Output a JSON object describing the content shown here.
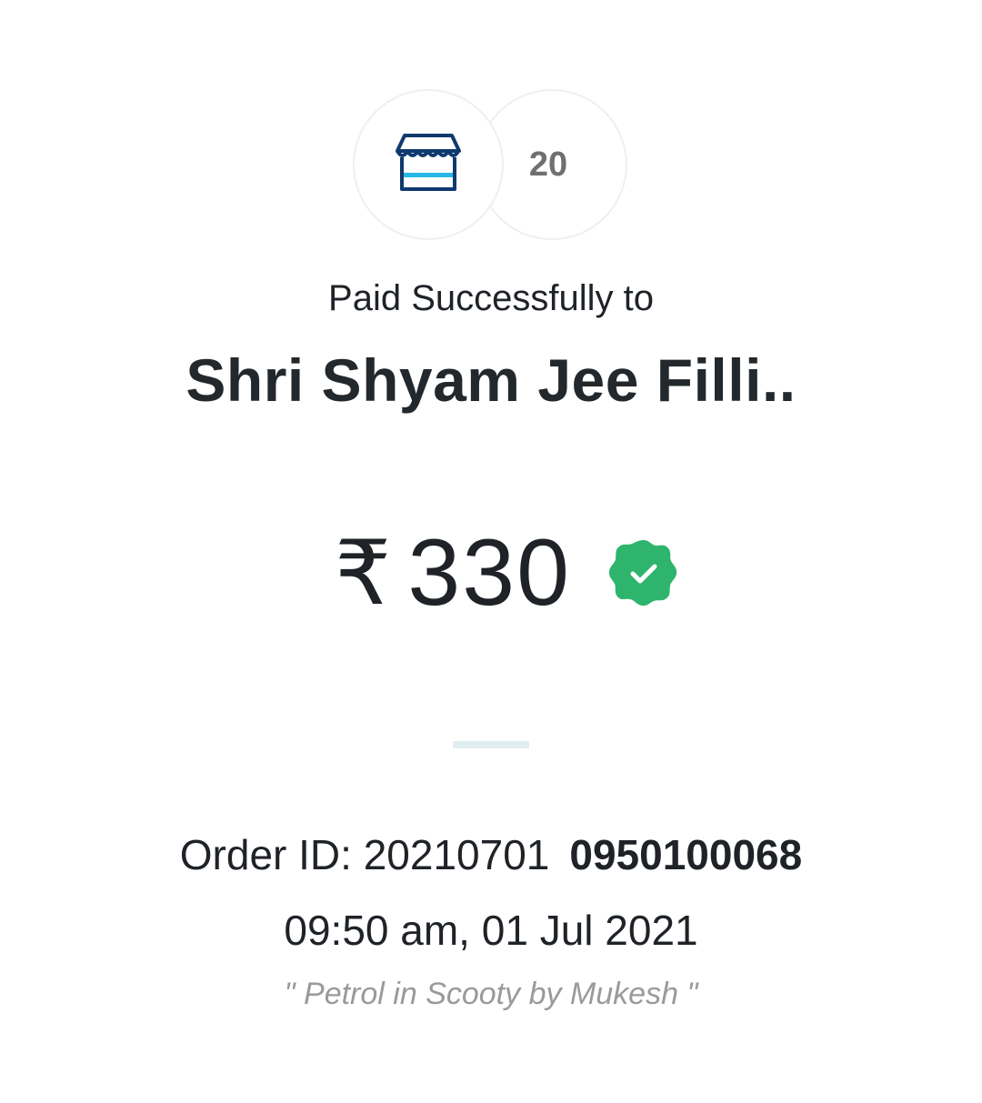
{
  "avatars": {
    "merchant_icon": "storefront-icon",
    "count": "20"
  },
  "payment": {
    "status_label": "Paid Successfully to",
    "merchant_name": "Shri Shyam Jee Filli..",
    "currency_symbol": "₹",
    "amount": "330",
    "verified_icon": "verified-check-badge-icon"
  },
  "order": {
    "label": "Order ID: 20210701",
    "id_bold": "0950100068",
    "datetime": "09:50 am, 01 Jul 2021",
    "note": "\" Petrol in Scooty by Mukesh \""
  },
  "colors": {
    "badge_green": "#2eb46d",
    "icon_navy": "#0f3a6e",
    "icon_cyan": "#25b7e8",
    "divider": "#e0eef0",
    "note_gray": "#9a9a9a"
  }
}
